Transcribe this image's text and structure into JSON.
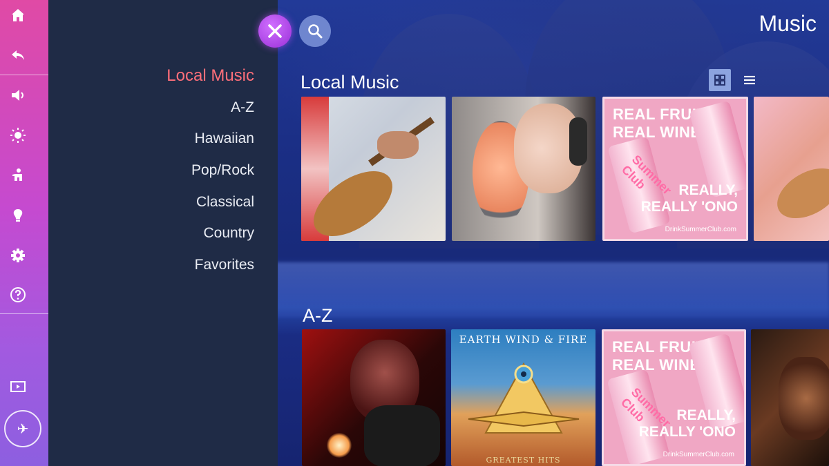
{
  "header": {
    "title": "Music",
    "close_icon": "close-x-icon",
    "search_icon": "search-icon"
  },
  "rail": {
    "items": [
      {
        "icon": "home-icon"
      },
      {
        "icon": "back-icon"
      },
      {
        "icon": "sound-icon"
      },
      {
        "icon": "brightness-icon"
      },
      {
        "icon": "accessibility-icon"
      },
      {
        "icon": "lightbulb-icon"
      },
      {
        "icon": "gear-icon"
      },
      {
        "icon": "help-icon"
      },
      {
        "icon": "input-source-icon"
      },
      {
        "icon": "airplane-icon"
      }
    ]
  },
  "categories": [
    {
      "label": "Local Music",
      "active": true
    },
    {
      "label": "A-Z",
      "active": false
    },
    {
      "label": "Hawaiian",
      "active": false
    },
    {
      "label": "Pop/Rock",
      "active": false
    },
    {
      "label": "Classical",
      "active": false
    },
    {
      "label": "Country",
      "active": false
    },
    {
      "label": "Favorites",
      "active": false
    }
  ],
  "sections": [
    {
      "title": "Local Music",
      "tiles": [
        "ukulele-photo",
        "singer-microphone-photo",
        "summer-club-ad",
        "ukulele-photo-partial"
      ]
    },
    {
      "title": "A-Z",
      "tiles": [
        "pianist-photo",
        "earth-wind-fire-album",
        "summer-club-ad",
        "dancer-photo-partial"
      ]
    }
  ],
  "ad": {
    "headline_line1": "REAL FRUIT,",
    "headline_line2": "REAL WINE",
    "tagline_line1": "REALLY,",
    "tagline_line2": "REALLY 'ONO",
    "url": "DrinkSummerClub.com",
    "can_label": "Summer Club"
  },
  "album": {
    "artist": "EARTH WIND & FIRE",
    "title": "GREATEST HITS"
  },
  "colors": {
    "rail_top": "#e04aa5",
    "rail_bottom": "#8d5fe0",
    "panel": "#1f2b46",
    "active_category": "#ff6f7a",
    "close_button": "#b040e8",
    "search_button": "#6f86cf"
  }
}
